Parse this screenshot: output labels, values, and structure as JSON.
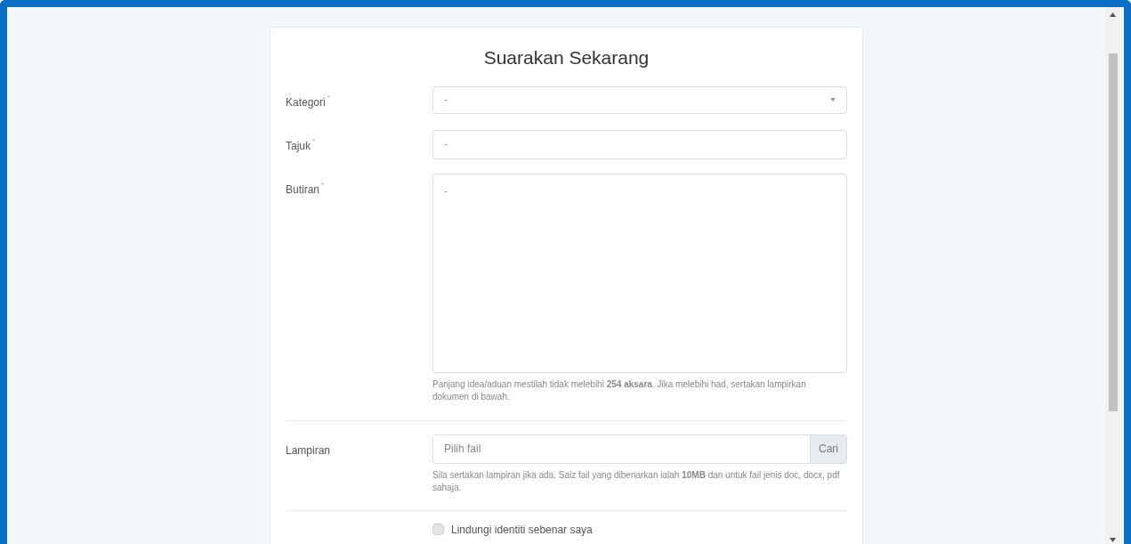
{
  "form": {
    "title": "Suarakan Sekarang",
    "fields": [
      {
        "kind": "select",
        "label": "Kategori",
        "mark": "*",
        "value": "-"
      },
      {
        "kind": "text",
        "label": "Tajuk",
        "mark": "*",
        "value": "-"
      },
      {
        "kind": "textarea",
        "label": "Butiran",
        "mark": "*",
        "value": "-",
        "help": "Panjang idea/aduan mestilah tidak melebihi **254 aksara**. Jika melebihi had, sertakan lampirkan dokumen di bawah."
      },
      {
        "kind": "file",
        "label": "Lampiran",
        "placeholder": "Pilih fail",
        "button": "Cari",
        "help": "Sila sertakan lampiran jika ada. Saiz fail yang dibenarkan ialah **10MB** dan untuk fail jenis doc, docx, pdf sahaja."
      },
      {
        "kind": "checkbox",
        "text": "Lindungi identiti sebenar saya",
        "checked": false
      }
    ]
  }
}
